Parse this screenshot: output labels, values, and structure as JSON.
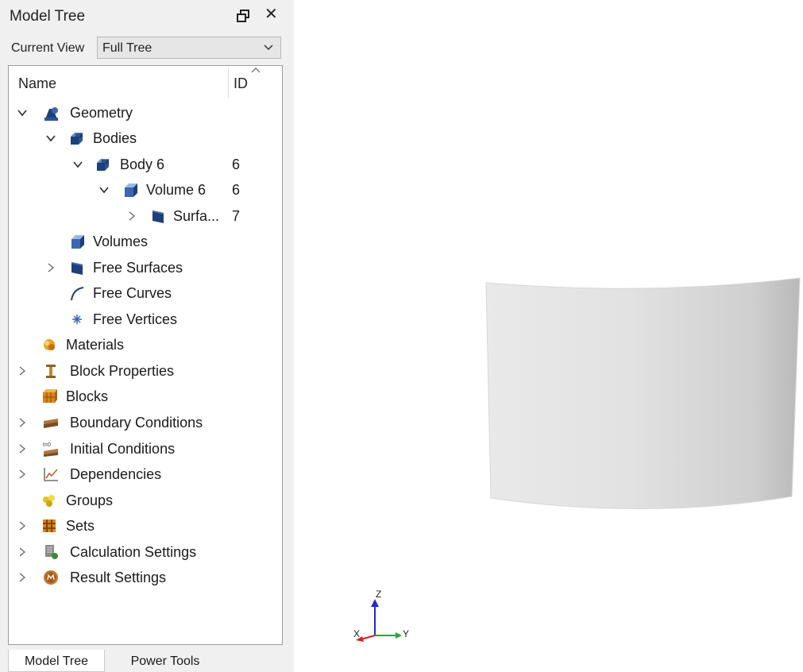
{
  "panel": {
    "title": "Model Tree",
    "view_label": "Current View",
    "view_value": "Full Tree",
    "col_name": "Name",
    "col_id": "ID"
  },
  "tree": [
    {
      "label": "Geometry",
      "id": "",
      "icon": "geometry-icon",
      "expander": "expanded"
    },
    {
      "label": "Bodies",
      "id": "",
      "icon": "body-icon",
      "expander": "expanded"
    },
    {
      "label": "Body 6",
      "id": "6",
      "icon": "body-icon",
      "expander": "expanded"
    },
    {
      "label": "Volume 6",
      "id": "6",
      "icon": "volume-icon",
      "expander": "expanded"
    },
    {
      "label": "Surfa...",
      "id": "7",
      "icon": "surface-icon",
      "expander": "collapsed"
    },
    {
      "label": "Volumes",
      "id": "",
      "icon": "volume-icon",
      "expander": "none"
    },
    {
      "label": "Free Surfaces",
      "id": "",
      "icon": "surface-icon",
      "expander": "collapsed"
    },
    {
      "label": "Free Curves",
      "id": "",
      "icon": "curve-icon",
      "expander": "none"
    },
    {
      "label": "Free Vertices",
      "id": "",
      "icon": "vertex-icon",
      "expander": "none"
    },
    {
      "label": "Materials",
      "id": "",
      "icon": "materials-icon",
      "expander": "none"
    },
    {
      "label": "Block Properties",
      "id": "",
      "icon": "i-beam-icon",
      "expander": "collapsed"
    },
    {
      "label": "Blocks",
      "id": "",
      "icon": "blocks-icon",
      "expander": "none"
    },
    {
      "label": "Boundary Conditions",
      "id": "",
      "icon": "boundary-conditions-icon",
      "expander": "collapsed"
    },
    {
      "label": "Initial Conditions",
      "id": "",
      "icon": "initial-conditions-icon",
      "expander": "collapsed"
    },
    {
      "label": "Dependencies",
      "id": "",
      "icon": "dependencies-graph-icon",
      "expander": "collapsed"
    },
    {
      "label": "Groups",
      "id": "",
      "icon": "groups-icon",
      "expander": "none"
    },
    {
      "label": "Sets",
      "id": "",
      "icon": "sets-grid-icon",
      "expander": "collapsed"
    },
    {
      "label": "Calculation Settings",
      "id": "",
      "icon": "calculation-settings-icon",
      "expander": "collapsed"
    },
    {
      "label": "Result Settings",
      "id": "",
      "icon": "result-settings-icon",
      "expander": "collapsed"
    }
  ],
  "tabs": {
    "model_tree": "Model Tree",
    "power_tools": "Power Tools"
  },
  "triad": {
    "z": "Z",
    "y": "Y",
    "x": "X"
  },
  "colors": {
    "accent_blue": "#1d3f7a",
    "panel_bg": "#f0f0f0",
    "surface_gray": "#dcdcdc"
  }
}
